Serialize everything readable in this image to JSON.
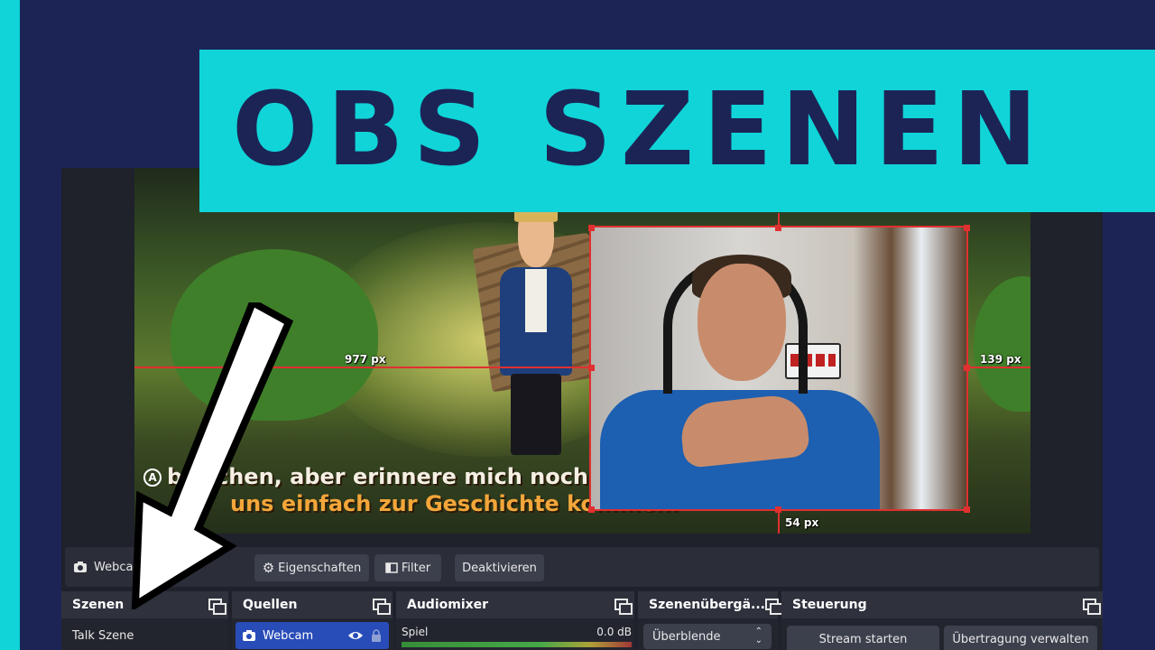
{
  "banner": {
    "title": "OBS SZENEN"
  },
  "preview": {
    "subtitle_line1": "bisschen, aber erinnere mich noch",
    "subtitle_line2": "uns einfach zur Geschichte kommen.",
    "subtitle_icon": "A",
    "guides": {
      "left": "977 px",
      "right": "139 px",
      "bottom": "54 px"
    }
  },
  "toolbar": {
    "current_source": "Webcam",
    "properties": "Eigenschaften",
    "filter": "Filter",
    "deactivate": "Deaktivieren"
  },
  "docks": {
    "scenes": {
      "title": "Szenen",
      "items": [
        "Talk Szene"
      ]
    },
    "sources": {
      "title": "Quellen",
      "items": [
        "Webcam"
      ]
    },
    "mixer": {
      "title": "Audiomixer",
      "channel": "Spiel",
      "level": "0.0 dB"
    },
    "transitions": {
      "title": "Szenenübergä...",
      "selected": "Überblende"
    },
    "controls": {
      "title": "Steuerung",
      "start_stream": "Stream starten",
      "manage_broadcast": "Übertragung verwalten"
    }
  },
  "colors": {
    "accent": "#10d4d8",
    "background": "#1c2456",
    "selection": "#e03030",
    "active_source": "#284cb8"
  },
  "icons": [
    "camera-icon",
    "gear-icon",
    "filter-icon",
    "eye-icon",
    "lock-icon",
    "float-dock-icon",
    "chevron-updown-icon",
    "arrow-pointer"
  ]
}
